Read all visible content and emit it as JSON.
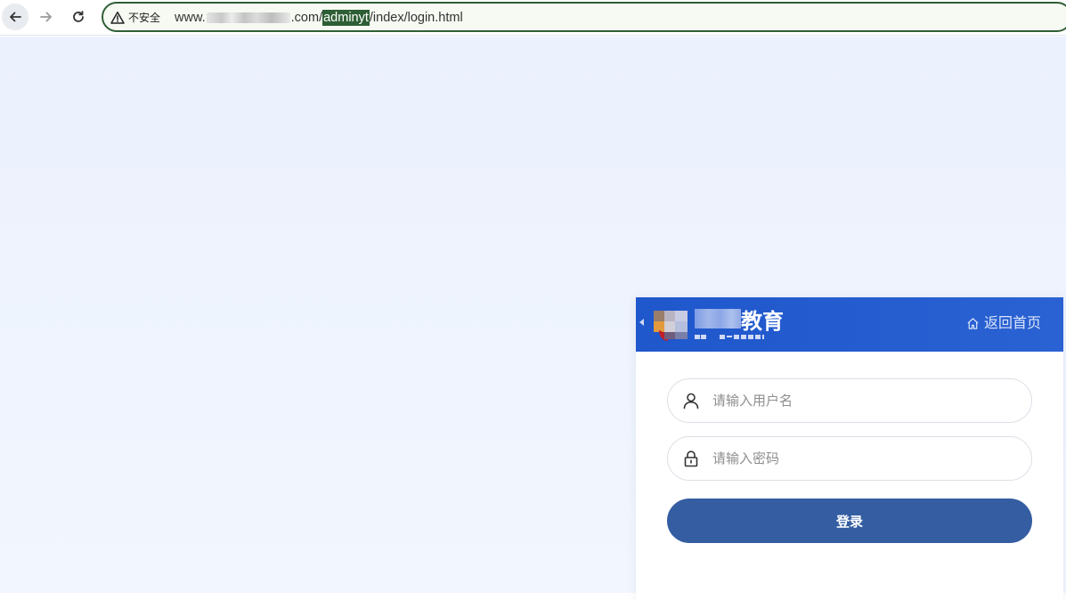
{
  "browser": {
    "security_label": "不安全",
    "url_prefix": "www.",
    "url_domain_suffix": ".com/",
    "url_highlight": "adminyt",
    "url_path": "/index/login.html"
  },
  "login": {
    "brand_text": "教育",
    "home_link": "返回首页",
    "username_placeholder": "请输入用户名",
    "password_placeholder": "请输入密码",
    "submit_label": "登录"
  },
  "colors": {
    "header_blue": "#1f57cc",
    "button_blue": "#345da2",
    "page_bg": "#ebf1fd",
    "omnibox_border": "#2f5f36"
  },
  "icons": {
    "back": "arrow-left-icon",
    "forward": "arrow-right-icon",
    "reload": "reload-icon",
    "security": "warning-triangle-icon",
    "home": "home-icon",
    "username": "user-icon",
    "password": "lock-icon"
  }
}
